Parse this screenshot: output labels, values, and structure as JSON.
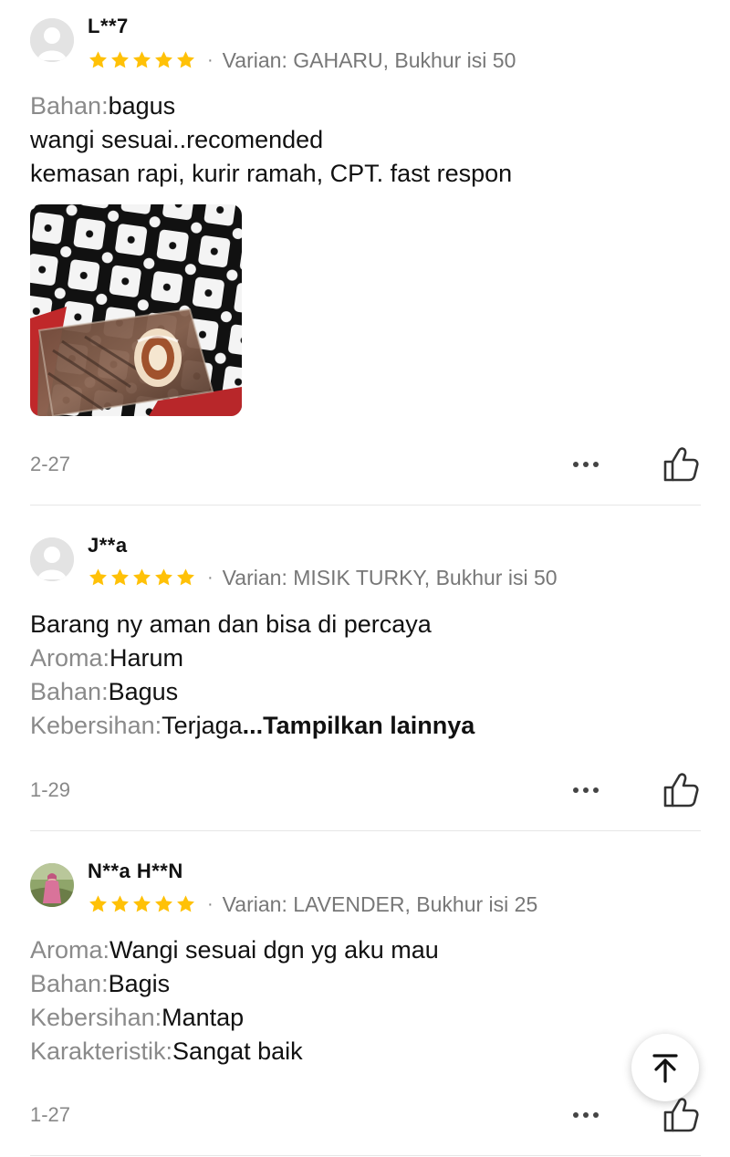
{
  "reviews": [
    {
      "username": "L**7",
      "rating": 5,
      "separator": "·",
      "variant": "Varian: GAHARU, Bukhur isi 50",
      "lines": [
        {
          "label": "Bahan:",
          "text": "bagus"
        },
        {
          "label": "",
          "text": "wangi sesuai..recomended"
        },
        {
          "label": "",
          "text": "kemasan rapi, kurir ramah, CPT. fast respon"
        }
      ],
      "has_photo": true,
      "date": "2-27"
    },
    {
      "username": "J**a",
      "rating": 5,
      "separator": "·",
      "variant": "Varian: MISIK TURKY, Bukhur isi 50",
      "lines": [
        {
          "label": "",
          "text": "Barang ny aman dan bisa di percaya"
        },
        {
          "label": "Aroma:",
          "text": "Harum"
        },
        {
          "label": "Bahan:",
          "text": "Bagus"
        },
        {
          "label": "Kebersihan:",
          "text": "Terjaga",
          "more": "...Tampilkan lainnya"
        }
      ],
      "has_photo": false,
      "date": "1-29"
    },
    {
      "username": "N**a H**N",
      "rating": 5,
      "separator": "·",
      "variant": "Varian: LAVENDER, Bukhur isi 25",
      "lines": [
        {
          "label": "Aroma:",
          "text": "Wangi sesuai dgn yg aku mau"
        },
        {
          "label": "Bahan:",
          "text": "Bagis"
        },
        {
          "label": "Kebersihan:",
          "text": "Mantap"
        },
        {
          "label": "Karakteristik:",
          "text": "Sangat baik"
        }
      ],
      "has_photo": false,
      "date": "1-27"
    }
  ],
  "icons": {
    "star": "star-icon",
    "more": "more-horizontal-icon",
    "like": "thumbs-up-icon",
    "scroll_top": "arrow-up-to-top-icon"
  },
  "colors": {
    "star": "#FFC107",
    "label": "#8A8A8A",
    "meta": "#888888",
    "divider": "#E6E6E6"
  }
}
